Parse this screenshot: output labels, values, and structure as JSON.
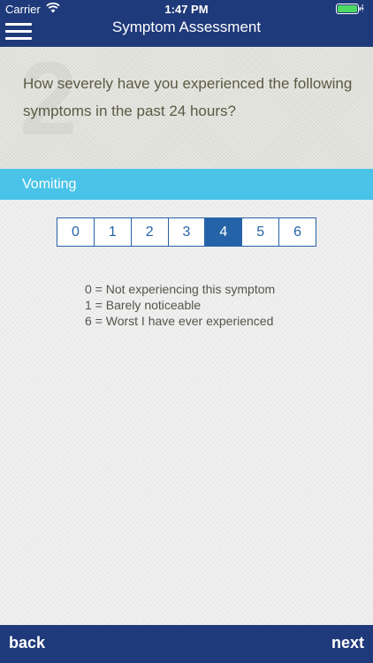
{
  "status_bar": {
    "carrier": "Carrier",
    "time": "1:47 PM",
    "wifi_icon": "wifi-icon",
    "battery_icon": "battery-icon"
  },
  "nav": {
    "title": "Symptom Assessment",
    "menu_icon": "hamburger-menu-icon"
  },
  "question": {
    "text": "How severely have you experienced the following symptoms in the past 24 hours?",
    "watermark_number": "2"
  },
  "symptom": {
    "name": "Vomiting"
  },
  "scale": {
    "options": [
      "0",
      "1",
      "2",
      "3",
      "4",
      "5",
      "6"
    ],
    "selected": "4"
  },
  "legend": {
    "lines": [
      "0 = Not experiencing this symptom",
      "1 = Barely noticeable",
      "6 = Worst I have ever experienced"
    ]
  },
  "footer": {
    "back_label": "back",
    "next_label": "next"
  },
  "colors": {
    "nav_bg": "#1f3a7a",
    "symptom_bar": "#4ac3e8",
    "scale_accent": "#2563a8",
    "battery_green": "#4cd964"
  }
}
